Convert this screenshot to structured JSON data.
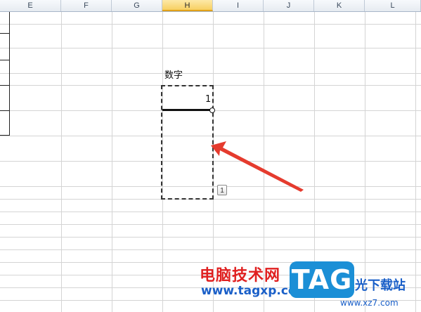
{
  "columns": [
    "E",
    "F",
    "G",
    "H",
    "I",
    "J",
    "K",
    "L"
  ],
  "active_column": "H",
  "cells": {
    "header_label": "数字",
    "first_value": "1"
  },
  "autofill_options_label": "1",
  "watermark": {
    "cn_text": "电脑技术网",
    "url_text": "www.tagxp.com",
    "logo_text": "TAG",
    "site_text": "光下载站",
    "small_text": "www.xz7.com"
  },
  "colors": {
    "arrow": "#e53b2e",
    "active_header": "#f7cf62",
    "grid": "#d4d4d4"
  },
  "icons": [
    "autofill-options-icon",
    "fill-handle-icon"
  ]
}
